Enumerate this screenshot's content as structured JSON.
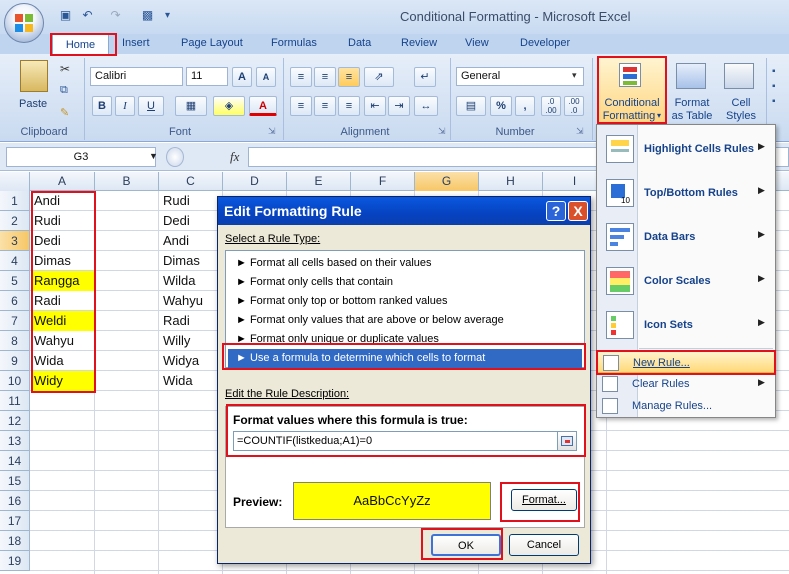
{
  "window": {
    "title": "Conditional Formatting - Microsoft Excel"
  },
  "tabs": [
    "Home",
    "Insert",
    "Page Layout",
    "Formulas",
    "Data",
    "Review",
    "View",
    "Developer"
  ],
  "ribbon": {
    "clipboard": {
      "label": "Clipboard",
      "paste": "Paste"
    },
    "font": {
      "label": "Font",
      "name": "Calibri",
      "size": "11",
      "bold": "B",
      "italic": "I",
      "underline": "U",
      "grow": "A",
      "shrink": "A",
      "fontcolor": "A"
    },
    "alignment": {
      "label": "Alignment"
    },
    "number": {
      "label": "Number",
      "format": "General",
      "percent": "%",
      "comma": ",",
      "inc": ".0 .00",
      "dec": ".00 .0"
    },
    "styles": {
      "cf_line1": "Conditional",
      "cf_line2": "Formatting",
      "ft_line1": "Format",
      "ft_line2": "as Table",
      "cs_line1": "Cell",
      "cs_line2": "Styles"
    }
  },
  "formula_bar": {
    "name_box": "G3",
    "fx": "fx"
  },
  "grid": {
    "columns": [
      "A",
      "B",
      "C",
      "D",
      "E",
      "F",
      "G",
      "H",
      "I"
    ],
    "rows": [
      "1",
      "2",
      "3",
      "4",
      "5",
      "6",
      "7",
      "8",
      "9",
      "10",
      "11",
      "12",
      "13",
      "14",
      "15",
      "16",
      "17",
      "18",
      "19"
    ],
    "col_a": [
      "Andi",
      "Rudi",
      "Dedi",
      "Dimas",
      "Rangga",
      "Radi",
      "Weldi",
      "Wahyu",
      "Wida",
      "Widy"
    ],
    "col_c": [
      "Rudi",
      "Dedi",
      "Andi",
      "Dimas",
      "Wilda",
      "Wahyu",
      "Radi",
      "Willy",
      "Widya",
      "Wida"
    ]
  },
  "colors": {
    "highlight": "#ffff00",
    "dialog_title": "#0a58df",
    "selection": "#316ac5",
    "annotation_red": "#e0101c"
  },
  "dialog": {
    "title": "Edit Formatting Rule",
    "help": "?",
    "close": "X",
    "select_rule_type": "Select a Rule Type:",
    "rule_types": [
      "Format all cells based on their values",
      "Format only cells that contain",
      "Format only top or bottom ranked values",
      "Format only values that are above or below average",
      "Format only unique or duplicate values",
      "Use a formula to determine which cells to format"
    ],
    "edit_description": "Edit the Rule Description:",
    "formula_label": "Format values where this formula is true:",
    "formula": "=COUNTIF(listkedua;A1)=0",
    "preview_label": "Preview:",
    "preview_text": "AaBbCcYyZz",
    "format_button": "Format...",
    "ok": "OK",
    "cancel": "Cancel"
  },
  "cf_menu": {
    "items": [
      "Highlight Cells Rules",
      "Top/Bottom Rules",
      "Data Bars",
      "Color Scales",
      "Icon Sets"
    ],
    "new_rule": "New Rule...",
    "clear_rules": "Clear Rules",
    "manage_rules": "Manage Rules..."
  }
}
